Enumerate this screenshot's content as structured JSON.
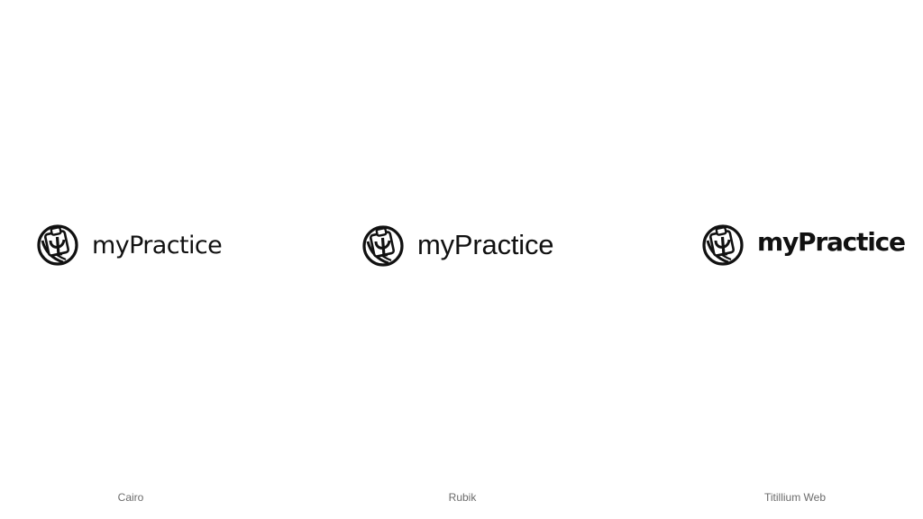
{
  "brand": {
    "name": "myPractice",
    "icon": "psi-clipboard-icon",
    "text_color": "#111111"
  },
  "variants": [
    {
      "font_label": "Cairo"
    },
    {
      "font_label": "Rubik"
    },
    {
      "font_label": "Titillium Web"
    }
  ],
  "colors": {
    "background": "#ffffff",
    "caption": "#6b6b6b"
  }
}
